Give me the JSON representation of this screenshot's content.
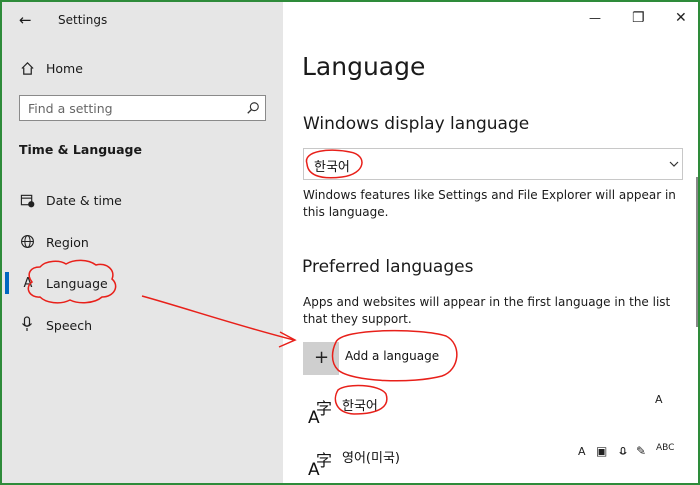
{
  "window": {
    "title": "Settings",
    "back_glyph": "←",
    "minimize_glyph": "—",
    "restore_glyph": "❐",
    "close_glyph": "✕"
  },
  "sidebar": {
    "home_label": "Home",
    "search_placeholder": "Find a setting",
    "section_title": "Time & Language",
    "items": [
      {
        "label": "Date & time",
        "icon": "calendar-clock-icon"
      },
      {
        "label": "Region",
        "icon": "globe-icon"
      },
      {
        "label": "Language",
        "icon": "language-icon",
        "selected": true
      },
      {
        "label": "Speech",
        "icon": "microphone-icon"
      }
    ]
  },
  "main": {
    "title": "Language",
    "display_language": {
      "heading": "Windows display language",
      "selected_value": "한국어",
      "description": "Windows features like Settings and File Explorer will appear in this language."
    },
    "preferred": {
      "heading": "Preferred languages",
      "description": "Apps and websites will appear in the first language in the list that they support.",
      "add_button_label": "Add a language",
      "add_icon": "+",
      "languages": [
        {
          "name": "한국어",
          "icon_glyph": "A字"
        },
        {
          "name": "영어(미국)",
          "icon_glyph": "A字"
        }
      ]
    }
  },
  "colors": {
    "frame_border": "#2e8b3a",
    "sidebar_bg": "#e6e6e6",
    "selection_accent": "#0067c0",
    "annotation_red": "#e8201a"
  }
}
